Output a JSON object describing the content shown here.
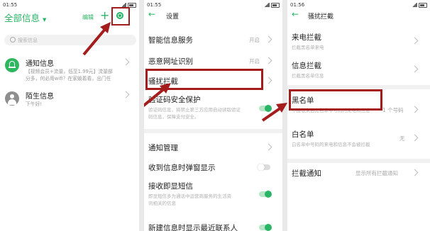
{
  "panel1": {
    "status_time": "01:55",
    "title": "全部信息",
    "edit_label": "编辑",
    "add_symbol": "+",
    "search_placeholder": "搜索信息",
    "conversations": [
      {
        "name": "通知信息",
        "preview_line1": "【视频会员+流量，低至1.99元】流量部",
        "preview_line2": "分多，何必用wifi？在家躺着看，出门任"
      },
      {
        "name": "陌生信息",
        "preview_line1": "下午好!",
        "preview_line2": ""
      }
    ]
  },
  "panel2": {
    "status_time": "01:55",
    "title": "设置",
    "items": [
      {
        "label": "智能信息服务",
        "value": "开启"
      },
      {
        "label": "恶意网址识别",
        "value": "开启"
      },
      {
        "label": "骚扰拦截",
        "value": ""
      },
      {
        "label": "验证码安全保护",
        "desc_line1": "验证码信息，将禁止第三方应用自动读取验证",
        "desc_line2": "码信息，保障支付安全。"
      },
      {
        "label": "通知管理",
        "value": ""
      },
      {
        "label": "收到信息时弹窗显示",
        "value": ""
      },
      {
        "label": "接收即显短信",
        "desc_line1": "即显短信多为通话中运营商服务的生活资",
        "desc_line2": "讯相关的信息"
      },
      {
        "label": "新建信息时显示最近联系人",
        "value": ""
      }
    ]
  },
  "panel3": {
    "status_time": "01:56",
    "title": "骚扰拦截",
    "items": [
      {
        "label": "来电拦截",
        "desc": "拦截黑名单来电"
      },
      {
        "label": "信息拦截",
        "desc": "拦截黑名单信息"
      },
      {
        "label": "黑名单",
        "desc": "不接收来自黑名单中号码的来电和信息",
        "value": "1 个号码"
      },
      {
        "label": "白名单",
        "desc": "白名单中号码的来电和信息不会被拦截",
        "value": "无"
      },
      {
        "label": "拦截通知",
        "value": "显示所有拦截通知"
      }
    ]
  },
  "colors": {
    "accent": "#29b466",
    "highlight": "#a41c1c"
  }
}
